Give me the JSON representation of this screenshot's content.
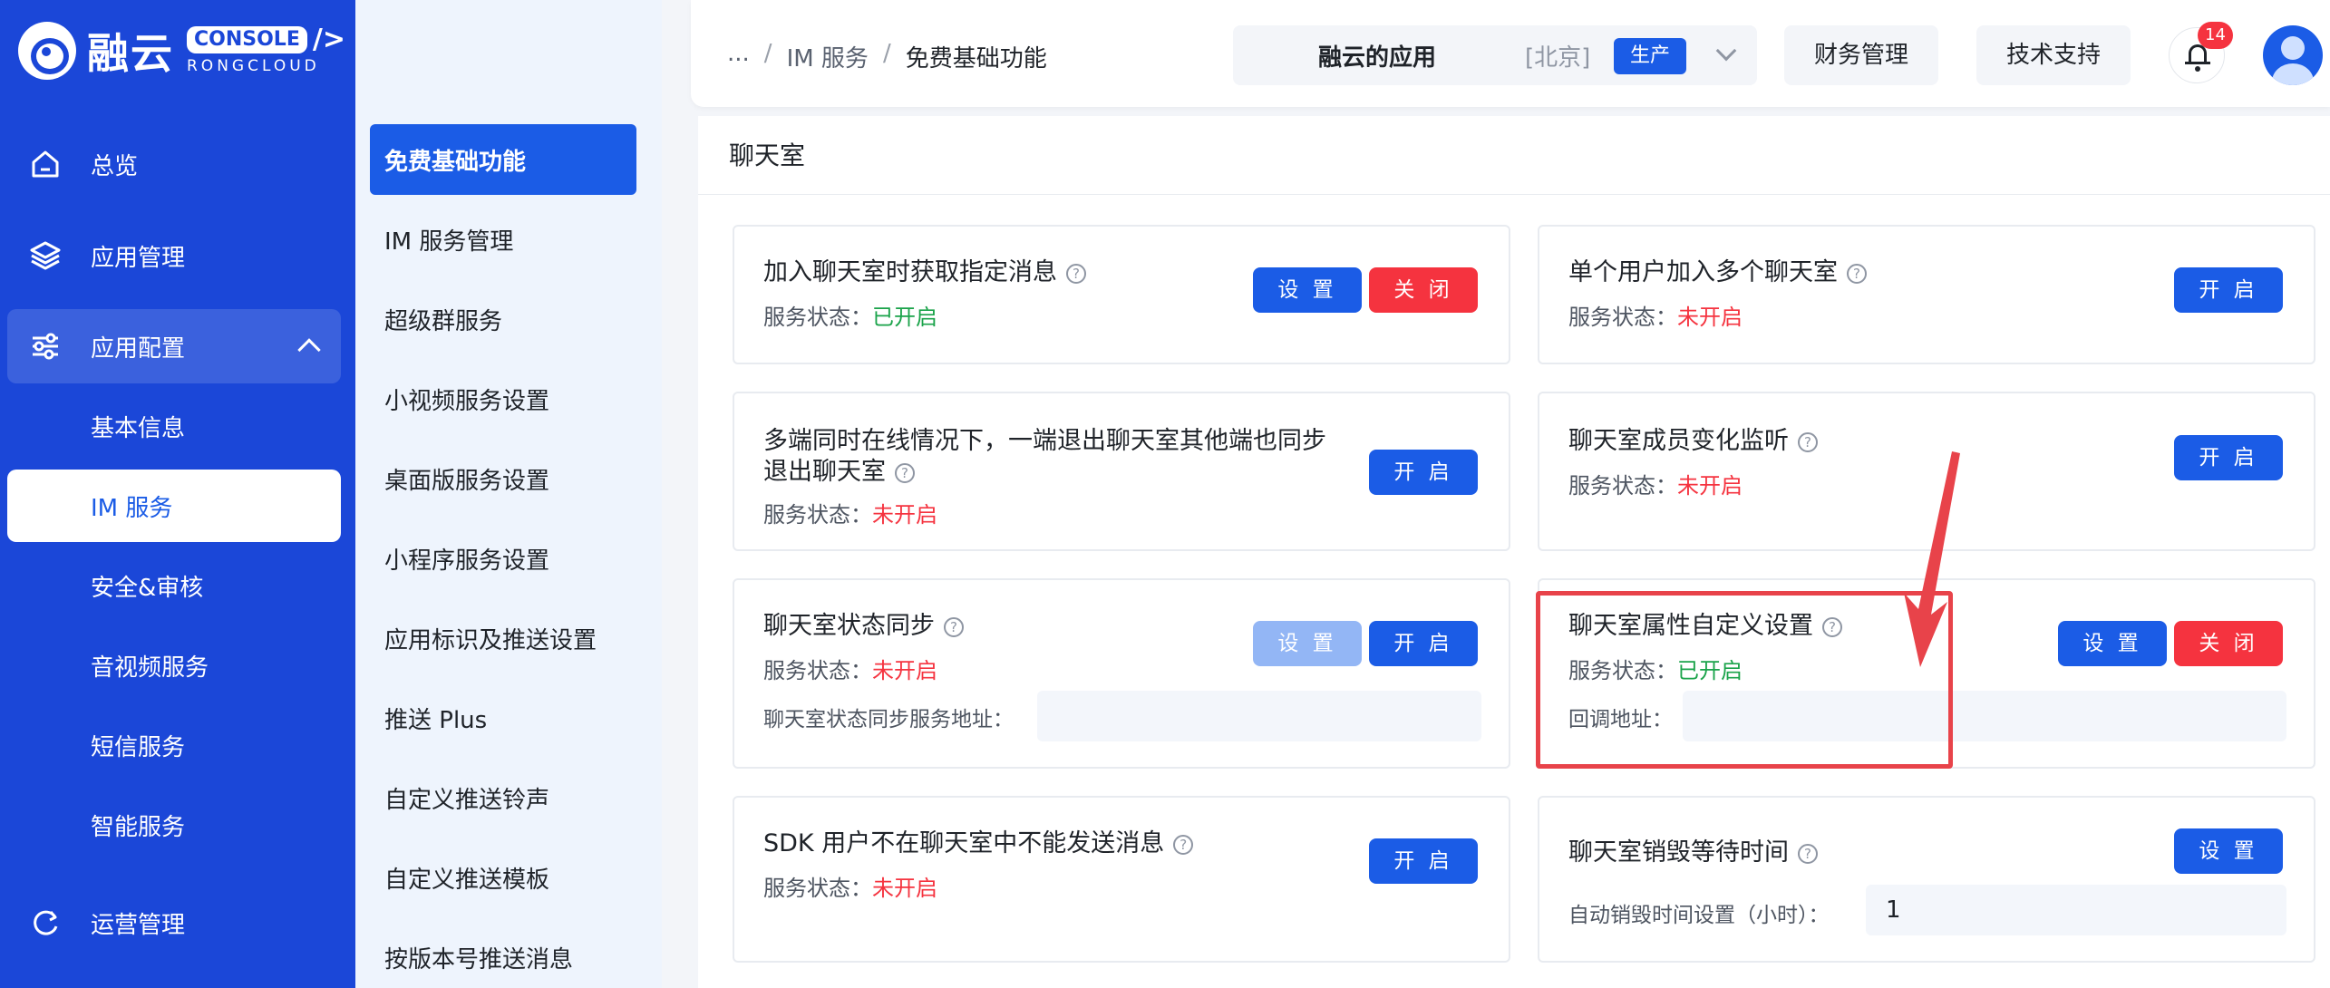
{
  "brand": {
    "name": "融云",
    "console": "CONSOLE",
    "console_mark": "/>",
    "sub": "RONGCLOUD"
  },
  "nav": [
    {
      "label": "总览",
      "icon": "home-icon"
    },
    {
      "label": "应用管理",
      "icon": "layers-icon"
    },
    {
      "label": "应用配置",
      "icon": "sliders-icon"
    }
  ],
  "nav_sub": [
    {
      "label": "基本信息"
    },
    {
      "label": "IM 服务"
    },
    {
      "label": "安全&审核"
    },
    {
      "label": "音视频服务"
    },
    {
      "label": "短信服务"
    },
    {
      "label": "智能服务"
    }
  ],
  "nav_bottom": {
    "label": "运营管理",
    "icon": "refresh-icon"
  },
  "subnav": [
    "免费基础功能",
    "IM 服务管理",
    "超级群服务",
    "小视频服务设置",
    "桌面版服务设置",
    "小程序服务设置",
    "应用标识及推送设置",
    "推送 Plus",
    "自定义推送铃声",
    "自定义推送模板",
    "按版本号推送消息"
  ],
  "header": {
    "breadcrumb": [
      "...",
      "IM 服务",
      "免费基础功能"
    ],
    "app_name": "融云的应用",
    "app_region": "[北京]",
    "app_env": "生产",
    "finance": "财务管理",
    "support": "技术支持",
    "notif_count": "14"
  },
  "panel": {
    "title": "聊天室"
  },
  "status_label": "服务状态：",
  "help_glyph": "?",
  "cards": [
    {
      "title": "加入聊天室时获取指定消息",
      "status": "已开启",
      "buttons": [
        "设 置",
        "关 闭"
      ]
    },
    {
      "title": "单个用户加入多个聊天室",
      "status": "未开启",
      "buttons": [
        "开 启"
      ]
    },
    {
      "title_line1": "多端同时在线情况下，一端退出聊天室其他端也同步",
      "title_line2": "退出聊天室",
      "status": "未开启",
      "buttons": [
        "开 启"
      ]
    },
    {
      "title": "聊天室成员变化监听",
      "status": "未开启",
      "buttons": [
        "开 启"
      ]
    },
    {
      "title": "聊天室状态同步",
      "status": "未开启",
      "buttons": [
        "设 置",
        "开 启"
      ],
      "field_label": "聊天室状态同步服务地址：",
      "field_value": ""
    },
    {
      "title": "聊天室属性自定义设置",
      "status": "已开启",
      "buttons": [
        "设 置",
        "关 闭"
      ],
      "field_label": "回调地址：",
      "field_value": ""
    },
    {
      "title": "SDK 用户不在聊天室中不能发送消息",
      "status": "未开启",
      "buttons": [
        "开 启"
      ]
    },
    {
      "title": "聊天室销毁等待时间",
      "buttons": [
        "设 置"
      ],
      "field_label": "自动销毁时间设置（小时）：",
      "field_value": "1"
    }
  ]
}
